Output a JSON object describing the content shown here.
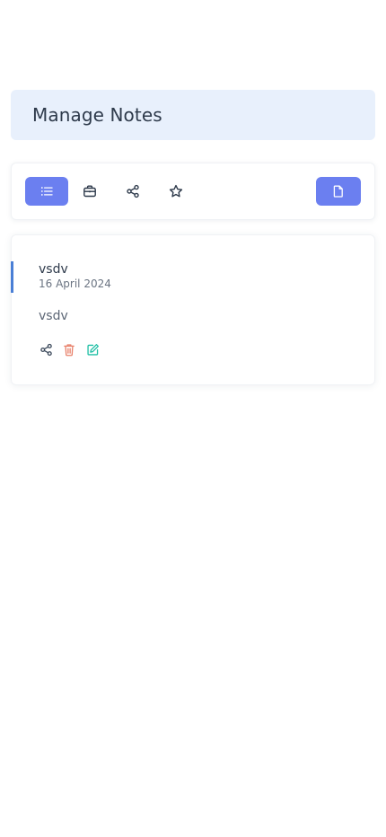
{
  "header": {
    "title": "Manage Notes"
  },
  "toolbar": {
    "buttons": [
      {
        "icon": "list-icon",
        "active": true
      },
      {
        "icon": "briefcase-icon",
        "active": false
      },
      {
        "icon": "share-icon",
        "active": false
      },
      {
        "icon": "star-icon",
        "active": false
      }
    ],
    "add_note_icon": "file-icon"
  },
  "notes": [
    {
      "title": "vsdv",
      "date": "16 April 2024",
      "body": "vsdv",
      "actions": [
        "share-icon",
        "trash-icon",
        "edit-icon"
      ]
    }
  ],
  "colors": {
    "accent": "#6b7ff0",
    "header_bg": "#e8f0fc",
    "note_accent": "#4a7fd6",
    "delete": "#e8806a",
    "edit": "#1fbfa5",
    "share": "#3d4a5c"
  }
}
